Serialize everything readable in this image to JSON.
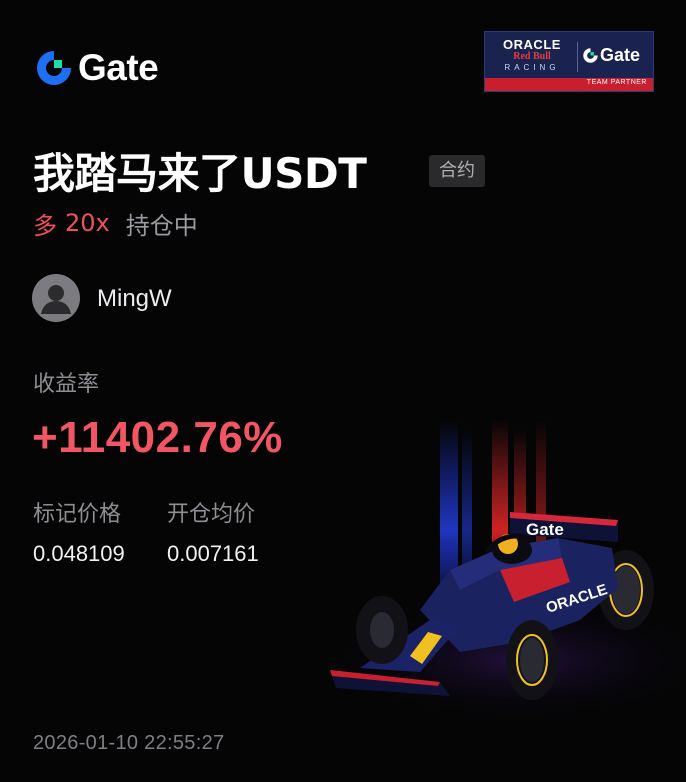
{
  "brand": {
    "name": "Gate",
    "icon": "gate-logo-icon",
    "color": "#1f6ff5",
    "accent": "#17e1a8"
  },
  "partner": {
    "oracle": "ORACLE",
    "redbull": "Red Bull",
    "racing": "RACING",
    "gate": "Gate",
    "strip": "TEAM PARTNER"
  },
  "position": {
    "title": "我踏马来了USDT",
    "tag": "合约",
    "direction": "多",
    "leverage": "20x",
    "status": "持仓中"
  },
  "user": {
    "name": "MingW",
    "avatar_icon": "default-avatar-icon"
  },
  "metrics": {
    "roi_label": "收益率",
    "roi_value": "+11402.76%",
    "mark_price_label": "标记价格",
    "mark_price": "0.048109",
    "entry_price_label": "开仓均价",
    "entry_price": "0.007161"
  },
  "timestamp": "2026-01-10 22:55:27",
  "colors": {
    "background": "#050506",
    "profit": "#f25563",
    "muted": "#8e8e93"
  }
}
